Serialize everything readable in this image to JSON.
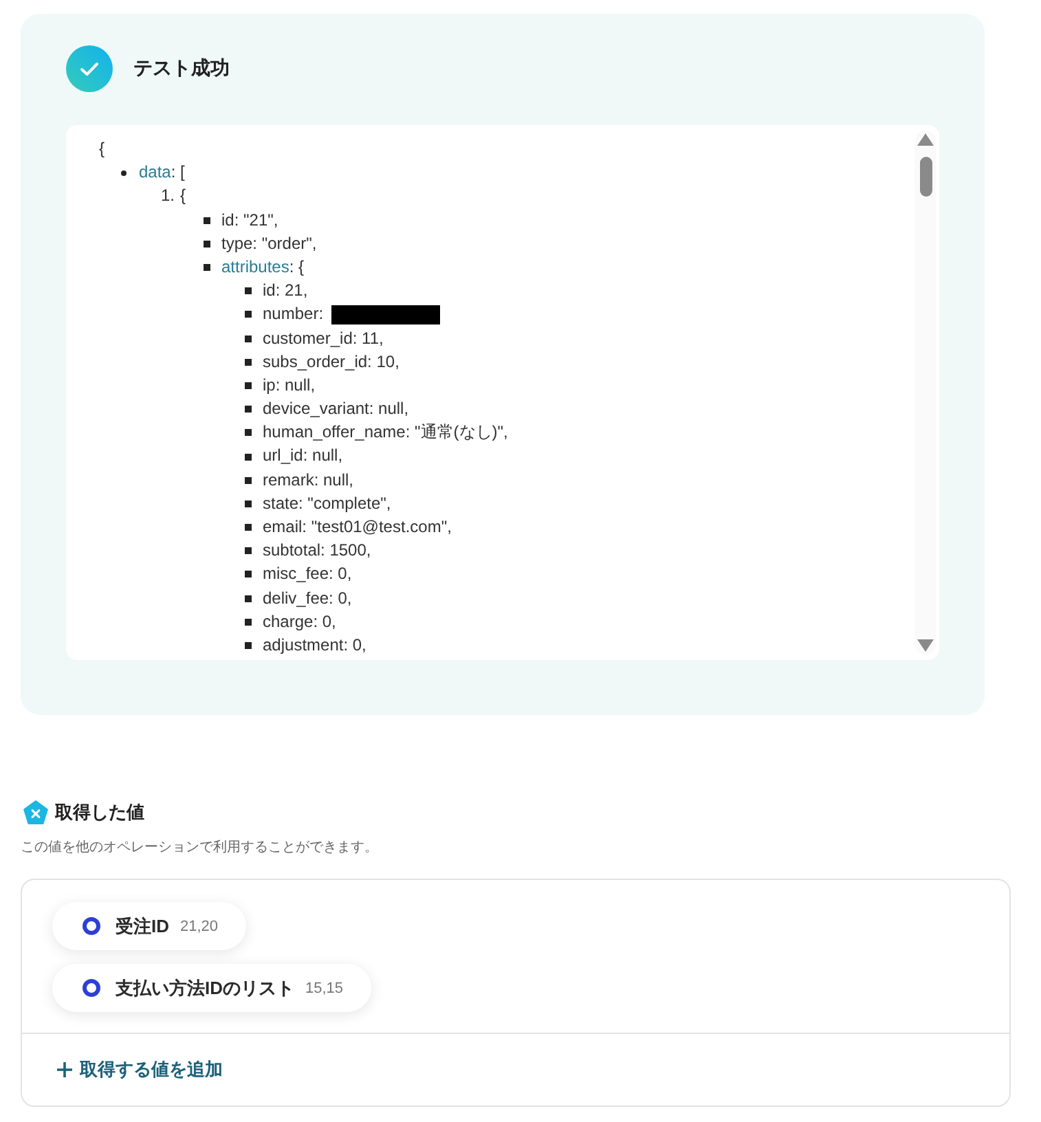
{
  "test_result": {
    "title": "テスト成功"
  },
  "json_view": {
    "open": "{",
    "items": [
      {
        "kind": "disc",
        "key": "data",
        "text": ": [",
        "children": [
          {
            "kind": "numbered",
            "marker": "1.",
            "text": "{",
            "children": [
              {
                "kind": "square",
                "text": "id: \"21\","
              },
              {
                "kind": "square",
                "text": "type: \"order\","
              },
              {
                "kind": "square",
                "key": "attributes",
                "text": ": {",
                "children": [
                  {
                    "kind": "square",
                    "text": "id: 21,"
                  },
                  {
                    "kind": "square",
                    "text": "number:",
                    "redacted": true
                  },
                  {
                    "kind": "square",
                    "text": "customer_id: 11,"
                  },
                  {
                    "kind": "square",
                    "text": "subs_order_id: 10,"
                  },
                  {
                    "kind": "square",
                    "text": "ip: null,"
                  },
                  {
                    "kind": "square",
                    "text": "device_variant: null,"
                  },
                  {
                    "kind": "square",
                    "text": "human_offer_name: \"通常(なし)\","
                  },
                  {
                    "kind": "square",
                    "text": "url_id: null,"
                  },
                  {
                    "kind": "square",
                    "text": "remark: null,"
                  },
                  {
                    "kind": "square",
                    "text": "state: \"complete\","
                  },
                  {
                    "kind": "square",
                    "text": "email: \"test01@test.com\","
                  },
                  {
                    "kind": "square",
                    "text": "subtotal: 1500,"
                  },
                  {
                    "kind": "square",
                    "text": "misc_fee: 0,"
                  },
                  {
                    "kind": "square",
                    "text": "deliv_fee: 0,"
                  },
                  {
                    "kind": "square",
                    "text": "charge: 0,"
                  },
                  {
                    "kind": "square",
                    "text": "adjustment: 0,"
                  }
                ]
              }
            ]
          }
        ]
      }
    ]
  },
  "extracted_values": {
    "title": "取得した値",
    "description": "この値を他のオペレーションで利用することができます。",
    "values": [
      {
        "label": "受注ID",
        "count": "21,20"
      },
      {
        "label": "支払い方法IDのリスト",
        "count": "15,15"
      }
    ],
    "add_button": "取得する値を追加"
  }
}
